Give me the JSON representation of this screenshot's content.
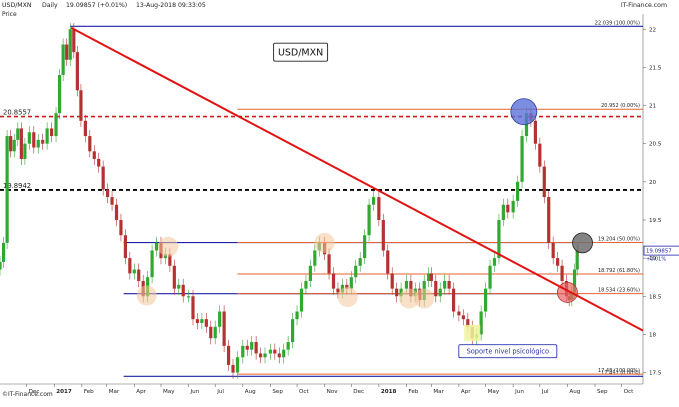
{
  "header": {
    "symbol": "USD/MXN",
    "period": "Daily",
    "quote": "19.09857 (+0.01%)",
    "timestamp": "13-Aug-2018 09:33:05",
    "brand": "IT-Finance.com",
    "price_label": "Price"
  },
  "footer": {
    "brand": "©IT-Finance.com"
  },
  "colors": {
    "fib": "#e8622c",
    "support": "#1f22a8",
    "trendline": "#e21212",
    "dotted_red": "#d11a1a",
    "dotted_black": "#000000",
    "candle_up": "#31a831",
    "candle_down": "#b43232",
    "highlight_orange": "#f3c99b",
    "highlight_yellow": "#eef59b",
    "circle_blue": "#5b72d8",
    "circle_red": "#e86565",
    "circle_gray": "#6e6e6e",
    "label_box_border": "#2c34b0"
  },
  "chart_data": {
    "type": "line",
    "title": "USD/MXN",
    "x_type": "date",
    "xlim": [
      "2016-11-01",
      "2018-10-25"
    ],
    "ylim": [
      17.35,
      22.2
    ],
    "y_scale": "linear",
    "grid": false,
    "y_ticks": [
      17.5,
      18,
      18.5,
      19,
      19.5,
      20,
      20.5,
      21,
      21.5,
      22
    ],
    "y_tick_labels": [
      "17.5",
      "18",
      "18.5",
      "19",
      "19.5",
      "20",
      "20.5",
      "21",
      "21.5",
      "22"
    ],
    "x_ticks": [
      {
        "date": "2016-12-01",
        "label": "Dec",
        "bold": false
      },
      {
        "date": "2017-01-01",
        "label": "2017",
        "bold": true
      },
      {
        "date": "2017-02-01",
        "label": "Feb",
        "bold": false
      },
      {
        "date": "2017-03-01",
        "label": "Mar",
        "bold": false
      },
      {
        "date": "2017-04-01",
        "label": "Apr",
        "bold": false
      },
      {
        "date": "2017-05-01",
        "label": "May",
        "bold": false
      },
      {
        "date": "2017-06-01",
        "label": "Jun",
        "bold": false
      },
      {
        "date": "2017-07-01",
        "label": "Jul",
        "bold": false
      },
      {
        "date": "2017-08-01",
        "label": "Aug",
        "bold": false
      },
      {
        "date": "2017-09-01",
        "label": "Sep",
        "bold": false
      },
      {
        "date": "2017-10-01",
        "label": "Oct",
        "bold": false
      },
      {
        "date": "2017-11-01",
        "label": "Nov",
        "bold": false
      },
      {
        "date": "2017-12-01",
        "label": "Dec",
        "bold": false
      },
      {
        "date": "2018-01-01",
        "label": "2018",
        "bold": true
      },
      {
        "date": "2018-02-01",
        "label": "Feb",
        "bold": false
      },
      {
        "date": "2018-03-01",
        "label": "Mar",
        "bold": false
      },
      {
        "date": "2018-04-01",
        "label": "Apr",
        "bold": false
      },
      {
        "date": "2018-05-01",
        "label": "May",
        "bold": false
      },
      {
        "date": "2018-06-01",
        "label": "Jun",
        "bold": false
      },
      {
        "date": "2018-07-01",
        "label": "Jul",
        "bold": false
      },
      {
        "date": "2018-08-01",
        "label": "Aug",
        "bold": false
      },
      {
        "date": "2018-09-01",
        "label": "Sep",
        "bold": false
      },
      {
        "date": "2018-10-01",
        "label": "Oct",
        "bold": false
      }
    ],
    "series": [
      {
        "style": "candlestick",
        "points": [
          [
            "2016-11-01",
            18.95
          ],
          [
            "2016-11-05",
            19.2
          ],
          [
            "2016-11-09",
            20.6
          ],
          [
            "2016-11-13",
            20.4
          ],
          [
            "2016-11-17",
            20.55
          ],
          [
            "2016-11-21",
            20.7
          ],
          [
            "2016-11-25",
            20.3
          ],
          [
            "2016-11-29",
            20.5
          ],
          [
            "2016-12-04",
            20.65
          ],
          [
            "2016-12-09",
            20.45
          ],
          [
            "2016-12-14",
            20.55
          ],
          [
            "2016-12-19",
            20.5
          ],
          [
            "2016-12-24",
            20.7
          ],
          [
            "2016-12-29",
            20.6
          ],
          [
            "2017-01-03",
            20.9
          ],
          [
            "2017-01-07",
            21.4
          ],
          [
            "2017-01-11",
            21.8
          ],
          [
            "2017-01-15",
            21.6
          ],
          [
            "2017-01-19",
            22.0
          ],
          [
            "2017-01-23",
            21.7
          ],
          [
            "2017-01-27",
            21.2
          ],
          [
            "2017-01-31",
            20.8
          ],
          [
            "2017-02-05",
            20.6
          ],
          [
            "2017-02-10",
            20.4
          ],
          [
            "2017-02-15",
            20.3
          ],
          [
            "2017-02-20",
            20.2
          ],
          [
            "2017-02-25",
            19.9
          ],
          [
            "2017-03-02",
            19.8
          ],
          [
            "2017-03-07",
            19.7
          ],
          [
            "2017-03-12",
            19.5
          ],
          [
            "2017-03-17",
            19.3
          ],
          [
            "2017-03-22",
            19.0
          ],
          [
            "2017-03-27",
            18.8
          ],
          [
            "2017-04-01",
            18.85
          ],
          [
            "2017-04-06",
            18.7
          ],
          [
            "2017-04-11",
            18.5
          ],
          [
            "2017-04-16",
            18.75
          ],
          [
            "2017-04-21",
            19.1
          ],
          [
            "2017-04-26",
            19.2
          ],
          [
            "2017-05-01",
            19.0
          ],
          [
            "2017-05-06",
            19.05
          ],
          [
            "2017-05-11",
            18.9
          ],
          [
            "2017-05-16",
            18.6
          ],
          [
            "2017-05-21",
            18.65
          ],
          [
            "2017-05-26",
            18.5
          ],
          [
            "2017-06-01",
            18.5
          ],
          [
            "2017-06-06",
            18.2
          ],
          [
            "2017-06-11",
            18.15
          ],
          [
            "2017-06-16",
            18.2
          ],
          [
            "2017-06-21",
            18.1
          ],
          [
            "2017-06-26",
            17.95
          ],
          [
            "2017-07-01",
            18.1
          ],
          [
            "2017-07-06",
            18.3
          ],
          [
            "2017-07-11",
            17.85
          ],
          [
            "2017-07-16",
            17.6
          ],
          [
            "2017-07-21",
            17.5
          ],
          [
            "2017-07-26",
            17.7
          ],
          [
            "2017-08-01",
            17.85
          ],
          [
            "2017-08-06",
            17.8
          ],
          [
            "2017-08-11",
            17.9
          ],
          [
            "2017-08-16",
            17.75
          ],
          [
            "2017-08-21",
            17.7
          ],
          [
            "2017-08-26",
            17.75
          ],
          [
            "2017-09-01",
            17.8
          ],
          [
            "2017-09-06",
            17.75
          ],
          [
            "2017-09-11",
            17.7
          ],
          [
            "2017-09-16",
            17.8
          ],
          [
            "2017-09-21",
            17.9
          ],
          [
            "2017-09-26",
            18.2
          ],
          [
            "2017-10-01",
            18.3
          ],
          [
            "2017-10-06",
            18.6
          ],
          [
            "2017-10-11",
            18.7
          ],
          [
            "2017-10-16",
            18.9
          ],
          [
            "2017-10-21",
            19.1
          ],
          [
            "2017-10-26",
            19.2
          ],
          [
            "2017-11-01",
            19.05
          ],
          [
            "2017-11-06",
            18.8
          ],
          [
            "2017-11-11",
            18.6
          ],
          [
            "2017-11-16",
            18.55
          ],
          [
            "2017-11-21",
            18.65
          ],
          [
            "2017-11-26",
            18.6
          ],
          [
            "2017-12-01",
            18.75
          ],
          [
            "2017-12-06",
            18.9
          ],
          [
            "2017-12-11",
            19.0
          ],
          [
            "2017-12-16",
            19.3
          ],
          [
            "2017-12-21",
            19.7
          ],
          [
            "2017-12-26",
            19.8
          ],
          [
            "2018-01-01",
            19.5
          ],
          [
            "2018-01-06",
            19.1
          ],
          [
            "2018-01-11",
            18.8
          ],
          [
            "2018-01-16",
            18.6
          ],
          [
            "2018-01-21",
            18.5
          ],
          [
            "2018-01-26",
            18.6
          ],
          [
            "2018-02-01",
            18.7
          ],
          [
            "2018-02-06",
            18.5
          ],
          [
            "2018-02-11",
            18.6
          ],
          [
            "2018-02-16",
            18.45
          ],
          [
            "2018-02-21",
            18.7
          ],
          [
            "2018-02-26",
            18.8
          ],
          [
            "2018-03-01",
            18.7
          ],
          [
            "2018-03-06",
            18.5
          ],
          [
            "2018-03-11",
            18.6
          ],
          [
            "2018-03-16",
            18.7
          ],
          [
            "2018-03-21",
            18.6
          ],
          [
            "2018-03-26",
            18.3
          ],
          [
            "2018-04-01",
            18.25
          ],
          [
            "2018-04-06",
            18.2
          ],
          [
            "2018-04-11",
            18.1
          ],
          [
            "2018-04-16",
            17.95
          ],
          [
            "2018-04-21",
            18.0
          ],
          [
            "2018-04-26",
            18.3
          ],
          [
            "2018-05-01",
            18.6
          ],
          [
            "2018-05-06",
            18.9
          ],
          [
            "2018-05-11",
            19.0
          ],
          [
            "2018-05-16",
            19.5
          ],
          [
            "2018-05-21",
            19.7
          ],
          [
            "2018-05-26",
            19.6
          ],
          [
            "2018-06-01",
            19.75
          ],
          [
            "2018-06-06",
            20.0
          ],
          [
            "2018-06-11",
            20.6
          ],
          [
            "2018-06-16",
            20.9
          ],
          [
            "2018-06-21",
            20.8
          ],
          [
            "2018-06-26",
            20.5
          ],
          [
            "2018-07-01",
            20.2
          ],
          [
            "2018-07-06",
            19.8
          ],
          [
            "2018-07-11",
            19.2
          ],
          [
            "2018-07-16",
            19.0
          ],
          [
            "2018-07-21",
            18.9
          ],
          [
            "2018-07-26",
            18.7
          ],
          [
            "2018-07-31",
            18.5
          ],
          [
            "2018-08-03",
            18.45
          ],
          [
            "2018-08-06",
            18.55
          ],
          [
            "2018-08-09",
            18.85
          ],
          [
            "2018-08-12",
            19.1
          ],
          [
            "2018-08-13",
            19.09857
          ]
        ]
      }
    ],
    "horizontal_lines": [
      {
        "kind": "support",
        "value": 22.039,
        "from": "2017-01-19",
        "to": "2018-10-25",
        "label": "22.039 (100.00%)"
      },
      {
        "kind": "fib",
        "value": 20.952,
        "from": "2017-07-26",
        "to": "2018-10-25",
        "label": "20.952 (0.00%)"
      },
      {
        "kind": "dotted_red",
        "value": 20.8557,
        "from": "2016-11-01",
        "to": "2018-10-25",
        "label": "20.8557"
      },
      {
        "kind": "dotted_black",
        "value": 19.8942,
        "from": "2016-11-01",
        "to": "2018-10-25",
        "label": "19.8942"
      },
      {
        "kind": "support",
        "value": 19.204,
        "from": "2017-03-20",
        "to": "2018-08-14",
        "label": ""
      },
      {
        "kind": "fib",
        "value": 19.204,
        "from": "2017-07-26",
        "to": "2018-10-25",
        "label": "19.204 (50.00%)"
      },
      {
        "kind": "fib",
        "value": 18.792,
        "from": "2017-07-26",
        "to": "2018-10-25",
        "label": "18.792 (61.80%)"
      },
      {
        "kind": "support",
        "value": 18.534,
        "from": "2017-03-20",
        "to": "2018-08-14",
        "label": ""
      },
      {
        "kind": "fib",
        "value": 18.534,
        "from": "2017-07-26",
        "to": "2018-10-25",
        "label": "18.534 (23.60%)"
      },
      {
        "kind": "support",
        "value": 17.451,
        "from": "2017-03-20",
        "to": "2018-10-25",
        "label": "17.451 (0.00%)"
      },
      {
        "kind": "fib",
        "value": 17.48,
        "from": "2017-07-26",
        "to": "2018-10-25",
        "label": "17.48 (100.00%)"
      }
    ],
    "trendline": {
      "start": [
        "2017-01-20",
        22.02
      ],
      "end": [
        "2018-10-25",
        18.05
      ]
    },
    "highlights": [
      {
        "shape": "circle",
        "date": "2017-04-15",
        "value": 18.51,
        "fill": "highlight_orange"
      },
      {
        "shape": "circle",
        "date": "2017-05-09",
        "value": 19.15,
        "fill": "highlight_orange"
      },
      {
        "shape": "circle",
        "date": "2017-11-01",
        "value": 19.2,
        "fill": "highlight_orange"
      },
      {
        "shape": "circle",
        "date": "2017-11-27",
        "value": 18.49,
        "fill": "highlight_orange"
      },
      {
        "shape": "circle",
        "date": "2018-02-04",
        "value": 18.47,
        "fill": "highlight_orange"
      },
      {
        "shape": "circle",
        "date": "2018-02-21",
        "value": 18.47,
        "fill": "highlight_orange"
      },
      {
        "shape": "rect",
        "date": "2018-04-16",
        "value": 18.02,
        "fill": "highlight_yellow"
      },
      {
        "shape": "circle",
        "date": "2018-06-13",
        "value": 20.92,
        "fill": "circle_blue"
      },
      {
        "shape": "circle",
        "date": "2018-08-01",
        "value": 18.55,
        "fill": "circle_red"
      },
      {
        "shape": "circle",
        "date": "2018-08-18",
        "value": 19.2,
        "fill": "circle_gray"
      }
    ],
    "annotations": [
      {
        "id": "title-box",
        "text": "USD/MXN",
        "date": "2017-10-05",
        "value": 21.7
      },
      {
        "id": "psych-box",
        "text": "Soporte nivel psicológico",
        "date": "2018-05-26",
        "value": 17.78
      }
    ],
    "last_price": {
      "value": 19.09857,
      "label": "19.09857",
      "change": "+0.01%"
    }
  }
}
